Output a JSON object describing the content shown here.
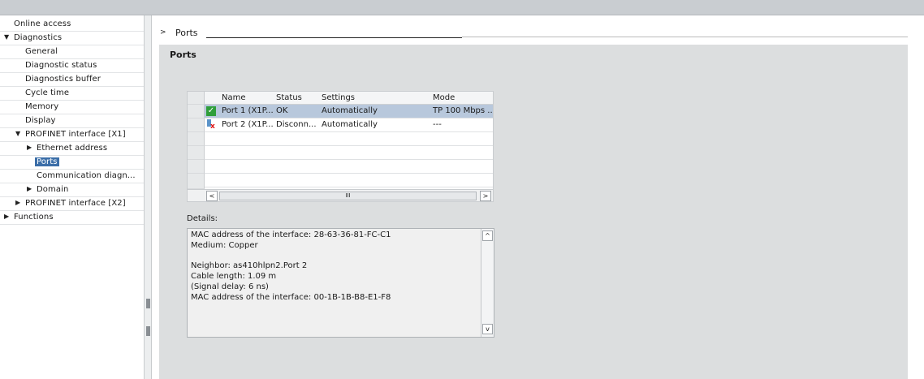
{
  "tree": {
    "items": [
      {
        "label": "Online access",
        "level": 0,
        "arrow": ""
      },
      {
        "label": "Diagnostics",
        "level": 0,
        "arrow": "▼"
      },
      {
        "label": "General",
        "level": 1,
        "arrow": ""
      },
      {
        "label": "Diagnostic status",
        "level": 1,
        "arrow": ""
      },
      {
        "label": "Diagnostics buffer",
        "level": 1,
        "arrow": ""
      },
      {
        "label": "Cycle time",
        "level": 1,
        "arrow": ""
      },
      {
        "label": "Memory",
        "level": 1,
        "arrow": ""
      },
      {
        "label": "Display",
        "level": 1,
        "arrow": ""
      },
      {
        "label": "PROFINET interface [X1]",
        "level": 1,
        "arrow": "▼"
      },
      {
        "label": "Ethernet address",
        "level": 2,
        "arrow": "▶"
      },
      {
        "label": "Ports",
        "level": 2,
        "arrow": "",
        "selected": true
      },
      {
        "label": "Communication diagn...",
        "level": 2,
        "arrow": ""
      },
      {
        "label": "Domain",
        "level": 2,
        "arrow": "▶"
      },
      {
        "label": "PROFINET interface [X2]",
        "level": 1,
        "arrow": "▶"
      },
      {
        "label": "Functions",
        "level": 0,
        "arrow": "▶"
      }
    ]
  },
  "breadcrumb": {
    "arrow": ">",
    "label": "Ports"
  },
  "panel": {
    "title": "Ports"
  },
  "ports_table": {
    "columns": [
      "Name",
      "Status",
      "Settings",
      "Mode"
    ],
    "rows": [
      {
        "name": "Port 1 (X1P...",
        "status": "OK",
        "settings": "Automatically",
        "mode": "TP 100 Mbps ...",
        "icon": "port-ok-icon",
        "selected": true
      },
      {
        "name": "Port 2 (X1P...",
        "status": "Disconn...",
        "settings": "Automatically",
        "mode": "---",
        "icon": "port-disconnected-icon",
        "selected": false
      }
    ],
    "empty_rows": 4,
    "scroll_left": "<",
    "scroll_right": ">",
    "scroll_thumb": "III"
  },
  "details": {
    "label": "Details:",
    "lines": [
      "MAC address of the interface: 28-63-36-81-FC-C1",
      "Medium: Copper",
      "",
      "Neighbor: as410hlpn2.Port 2",
      " Cable length: 1.09 m",
      " (Signal delay: 6 ns)",
      " MAC address of the interface: 00-1B-1B-B8-E1-F8"
    ],
    "scroll_up": "^",
    "scroll_down": "v"
  },
  "colors": {
    "selection": "#3b6ea8",
    "row_selected": "#b8c8dc",
    "ok_green": "#2f9e3a",
    "panel_bg": "#dcdedf"
  }
}
